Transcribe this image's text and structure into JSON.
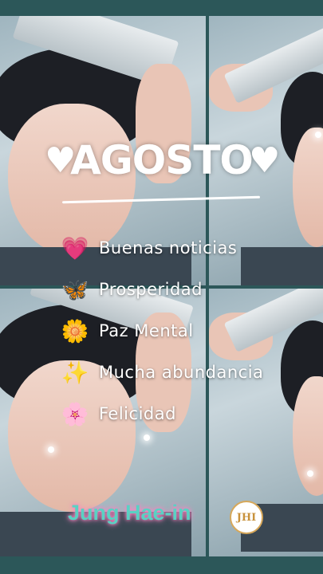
{
  "title": "AGOSTO",
  "heart_symbol": "♥",
  "wishes": [
    {
      "icon": "heart-icon",
      "glyph": "💗",
      "label": "Buenas noticias"
    },
    {
      "icon": "butterfly-icon",
      "glyph": "🦋",
      "label": "Prosperidad"
    },
    {
      "icon": "flower-icon",
      "glyph": "🌼",
      "label": "Paz Mental"
    },
    {
      "icon": "sparkles-icon",
      "glyph": "✨",
      "label": "Mucha abundancia"
    },
    {
      "icon": "blossom-icon",
      "glyph": "🌸",
      "label": "Felicidad"
    }
  ],
  "name": "Jung Hae-in",
  "logo_text": "JHI",
  "colors": {
    "frame": "#2c5759",
    "name_text": "#5ad1c3",
    "name_glow": "#ff8fc8"
  }
}
